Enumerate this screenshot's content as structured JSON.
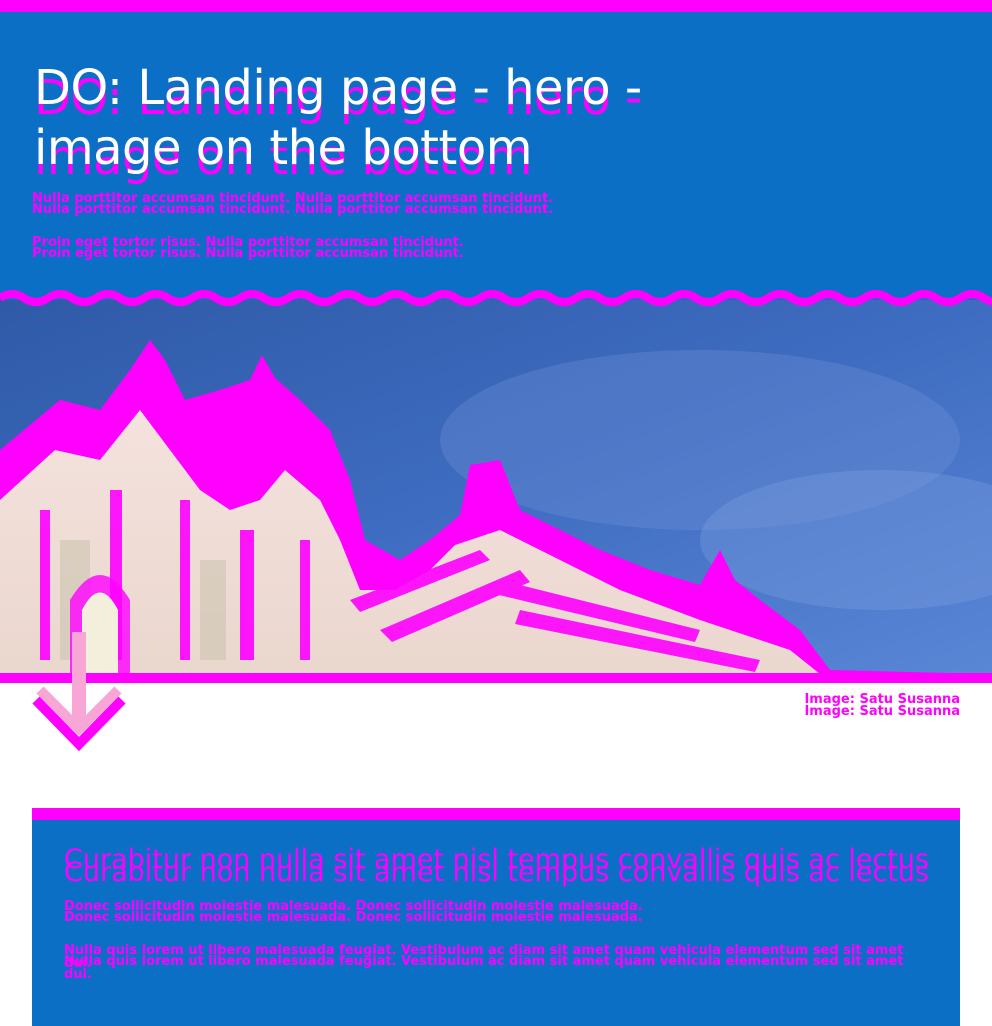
{
  "hero": {
    "title": "DO: Landing page - hero - image on the bottom",
    "paragraph_1": "Nulla porttitor accumsan tincidunt. Nulla porttitor accumsan tincidunt.",
    "paragraph_2": "Proin eget tortor risus. Nulla porttitor accumsan tincidunt."
  },
  "image": {
    "caption": "Image: Satu Susanna"
  },
  "card": {
    "title": "Curabitur non nulla sit amet nisl tempus convallis quis ac lectus",
    "paragraph_1": "Donec sollicitudin molestie malesuada. Donec sollicitudin molestie malesuada.",
    "paragraph_2": "Nulla quis lorem ut libero malesuada feugiat. Vestibulum ac diam sit amet quam vehicula elementum sed sit amet dui."
  },
  "colors": {
    "brand_blue": "#0b6fc6",
    "accent_magenta": "#ff00ff",
    "arrow_pink": "#f7a6d6"
  },
  "icons": {
    "scroll_arrow": "arrow-down-icon"
  }
}
